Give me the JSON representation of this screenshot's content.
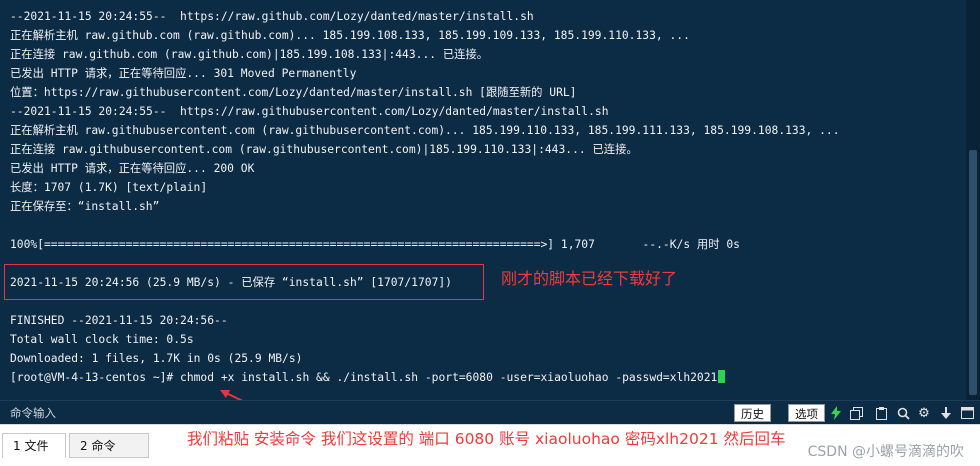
{
  "terminal": {
    "lines": [
      "--2021-11-15 20:24:55--  https://raw.github.com/Lozy/danted/master/install.sh",
      "正在解析主机 raw.github.com (raw.github.com)... 185.199.108.133, 185.199.109.133, 185.199.110.133, ...",
      "正在连接 raw.github.com (raw.github.com)|185.199.108.133|:443... 已连接。",
      "已发出 HTTP 请求，正在等待回应... 301 Moved Permanently",
      "位置：https://raw.githubusercontent.com/Lozy/danted/master/install.sh [跟随至新的 URL]",
      "--2021-11-15 20:24:55--  https://raw.githubusercontent.com/Lozy/danted/master/install.sh",
      "正在解析主机 raw.githubusercontent.com (raw.githubusercontent.com)... 185.199.110.133, 185.199.111.133, 185.199.108.133, ...",
      "正在连接 raw.githubusercontent.com (raw.githubusercontent.com)|185.199.110.133|:443... 已连接。",
      "已发出 HTTP 请求，正在等待回应... 200 OK",
      "长度：1707 (1.7K) [text/plain]",
      "正在保存至：“install.sh”",
      "",
      "100%[=========================================================================>] 1,707       --.-K/s 用时 0s",
      "",
      "2021-11-15 20:24:56 (25.9 MB/s) - 已保存 “install.sh” [1707/1707])",
      "",
      "FINISHED --2021-11-15 20:24:56--",
      "Total wall clock time: 0.5s",
      "Downloaded: 1 files, 1.7K in 0s (25.9 MB/s)"
    ],
    "prompt_line": "[root@VM-4-13-centos ~]# chmod +x install.sh && ./install.sh -port=6080 -user=xiaoluohao -passwd=xlh2021"
  },
  "annotations": {
    "script_downloaded": "刚才的脚本已经下载好了",
    "paste_instruction": "我们粘贴 安装命令  我们这设置的 端口 6080 账号 xiaoluohao 密码xlh2021  然后回车"
  },
  "command_bar": {
    "label": "命令输入",
    "history_button": "历史",
    "options_button": "选项"
  },
  "tabs": [
    {
      "label": "1 文件"
    },
    {
      "label": "2 命令"
    }
  ],
  "watermark": "CSDN @小螺号滴滴的吹",
  "colors": {
    "terminal_bg": "#0c2b45",
    "terminal_text": "#f2f2f2",
    "cursor": "#2fd14f",
    "annotation_red": "#ee3b3b"
  },
  "icons": [
    "flash-icon",
    "copy-icon",
    "paste-icon",
    "search-icon",
    "gear-icon",
    "download-icon",
    "window-icon"
  ]
}
